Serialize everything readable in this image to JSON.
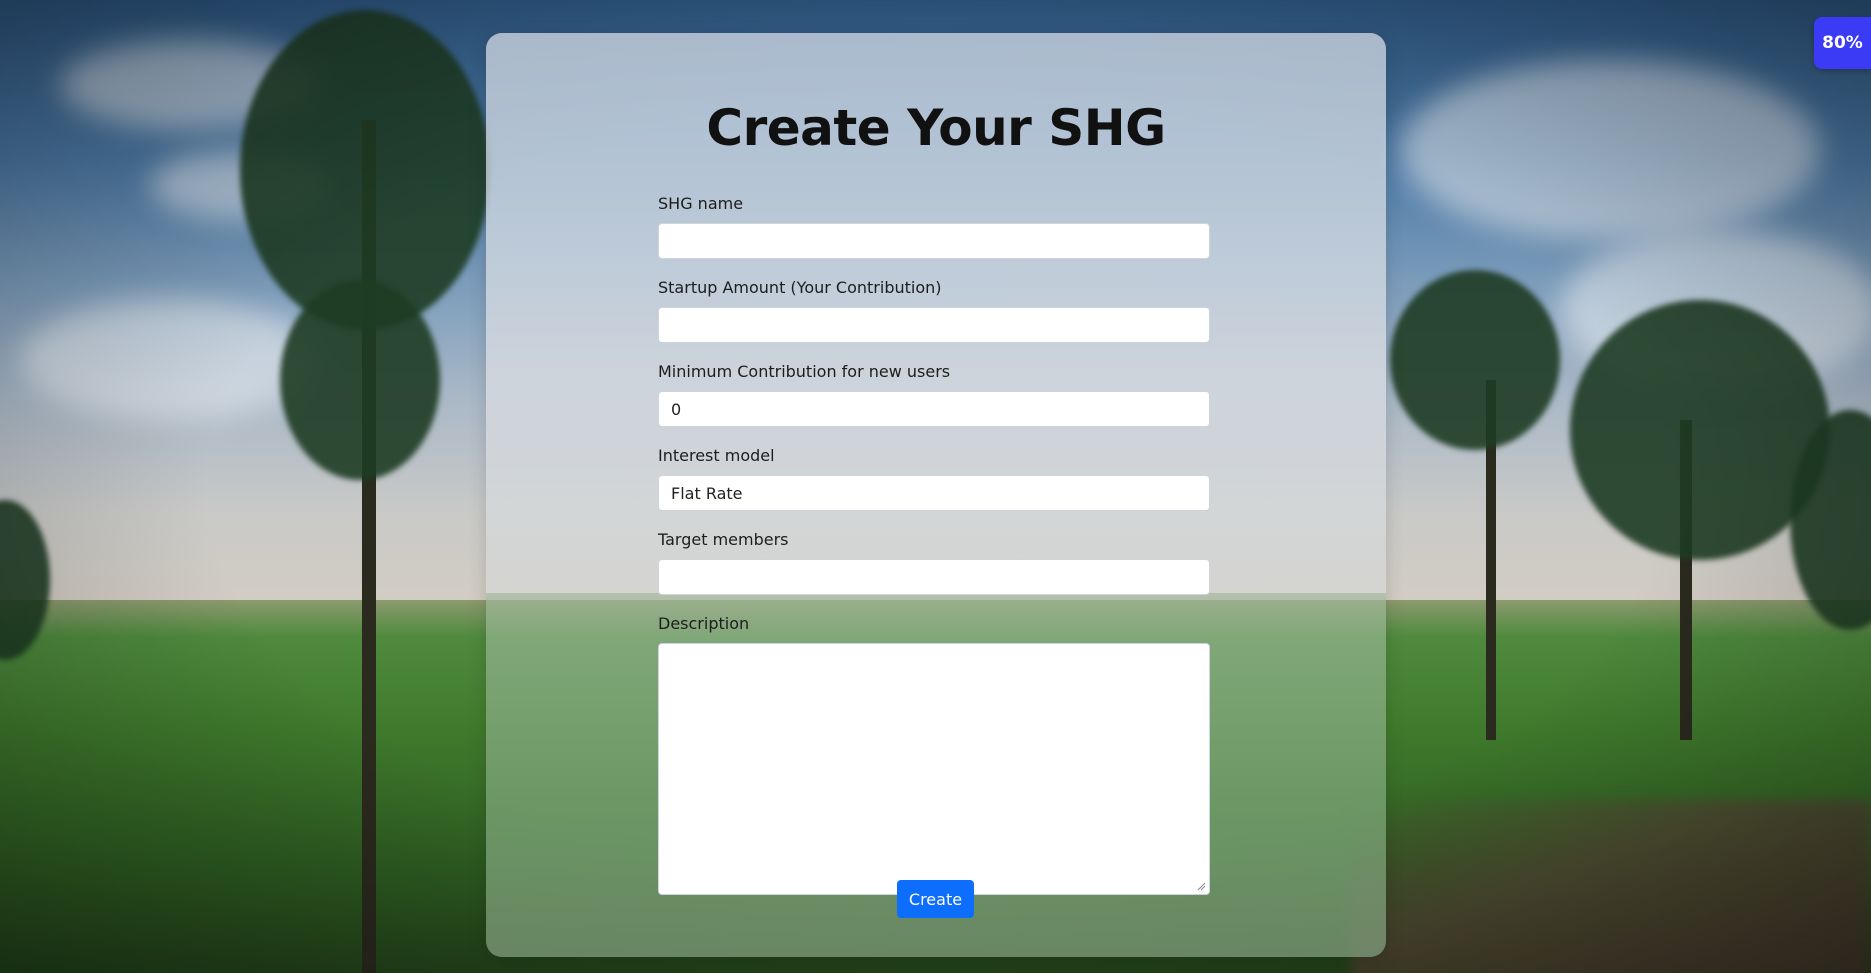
{
  "page": {
    "title": "Create Your SHG"
  },
  "form": {
    "shg_name": {
      "label": "SHG name",
      "value": ""
    },
    "startup_amount": {
      "label": "Startup Amount (Your Contribution)",
      "value": ""
    },
    "min_contribution": {
      "label": "Minimum Contribution for new users",
      "value": "0"
    },
    "interest_model": {
      "label": "Interest model",
      "value": "Flat Rate"
    },
    "target_members": {
      "label": "Target members",
      "value": ""
    },
    "description": {
      "label": "Description",
      "value": ""
    },
    "submit_label": "Create"
  },
  "zoom_badge": {
    "label": "80%"
  },
  "colors": {
    "primary_button": "#0d6efd",
    "zoom_badge": "#3b3bf5"
  }
}
